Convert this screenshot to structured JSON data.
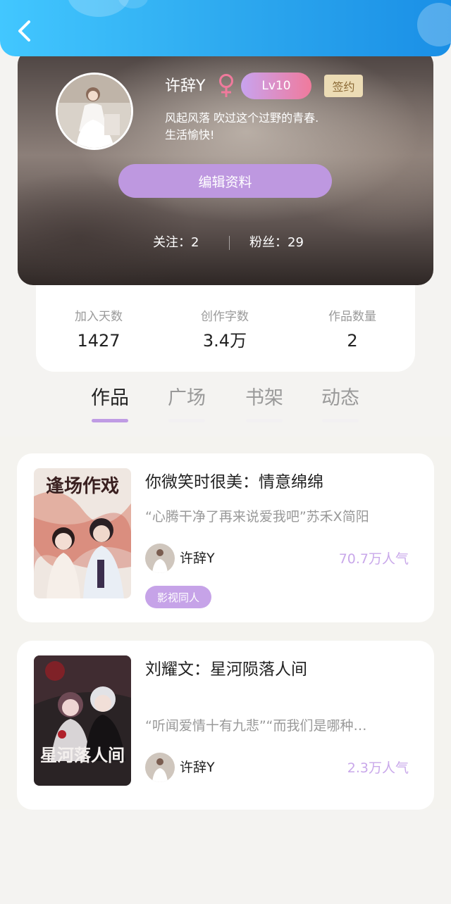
{
  "header": {
    "back_icon": "chevron-left-icon",
    "accent": "#2ca7ee"
  },
  "profile": {
    "name": "许辞Y",
    "gender_icon": "female-icon",
    "gender_color": "#f07a9c",
    "level": "Lv10",
    "signed_label": "签约",
    "bio": "风起风落 吹过这个过野的青春.\n生活愉快!",
    "edit_label": "编辑资料",
    "following": "关注：2",
    "fans": "粉丝：29"
  },
  "stats": [
    {
      "label": "加入天数",
      "value": "1427"
    },
    {
      "label": "创作字数",
      "value": "3.4万"
    },
    {
      "label": "作品数量",
      "value": "2"
    }
  ],
  "tabs": [
    {
      "label": "作品",
      "active": true
    },
    {
      "label": "广场",
      "active": false
    },
    {
      "label": "书架",
      "active": false
    },
    {
      "label": "动态",
      "active": false
    }
  ],
  "works": [
    {
      "title": "你微笑时很美：情意绵绵",
      "desc": "“心腾干净了再来说爱我吧”苏禾X简阳",
      "author": "许辞Y",
      "popularity": "70.7万人气",
      "tag": "影视同人",
      "cover_text": "逢场作戏"
    },
    {
      "title": "刘耀文：星河陨落人间",
      "desc": "“听闻爱情十有九悲”“而我们是哪种…",
      "author": "许辞Y",
      "popularity": "2.3万人气",
      "cover_text": "星河落人间"
    }
  ],
  "colors": {
    "purple_button": "#be98e0",
    "popularity": "#c9a8ea",
    "tag": "#c6a3e8"
  }
}
